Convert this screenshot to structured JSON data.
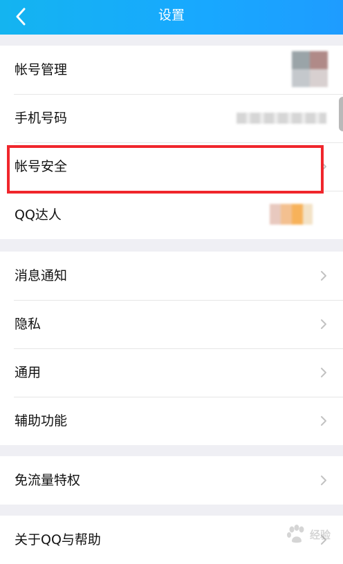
{
  "header": {
    "title": "设置",
    "back_icon": "chevron-left-icon"
  },
  "groups": [
    {
      "items": [
        {
          "label": "帐号管理",
          "trailing": "blurred-avatar"
        },
        {
          "label": "手机号码",
          "trailing": "blurred-number"
        },
        {
          "label": "帐号安全",
          "trailing": "chevron",
          "highlighted": true
        },
        {
          "label": "QQ达人",
          "trailing": "blurred-badge"
        }
      ]
    },
    {
      "items": [
        {
          "label": "消息通知",
          "trailing": "chevron"
        },
        {
          "label": "隐私",
          "trailing": "chevron"
        },
        {
          "label": "通用",
          "trailing": "chevron"
        },
        {
          "label": "辅助功能",
          "trailing": "chevron"
        }
      ]
    },
    {
      "items": [
        {
          "label": "免流量特权",
          "trailing": "chevron"
        }
      ]
    },
    {
      "items": [
        {
          "label": "关于QQ与帮助",
          "trailing": "chevron"
        }
      ]
    }
  ],
  "highlight_color": "#f0262c",
  "header_color": "#18a8ff",
  "watermark": {
    "text": "经验",
    "icon": "baidu-paw-icon"
  }
}
